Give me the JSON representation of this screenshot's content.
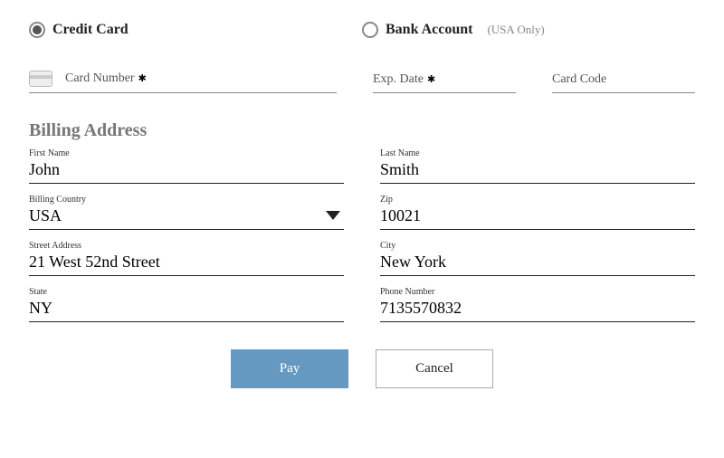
{
  "payment_method": {
    "credit_card_label": "Credit Card",
    "bank_account_label": "Bank Account",
    "bank_account_sub": "(USA Only)"
  },
  "card": {
    "number_label": "Card Number",
    "number_value": "",
    "exp_label": "Exp. Date",
    "exp_value": "",
    "code_label": "Card Code",
    "code_value": "",
    "required_mark": "✱"
  },
  "billing": {
    "title": "Billing Address",
    "first_name_label": "First Name",
    "first_name_value": "John",
    "last_name_label": "Last Name",
    "last_name_value": "Smith",
    "country_label": "Billing Country",
    "country_value": "USA",
    "zip_label": "Zip",
    "zip_value": "10021",
    "street_label": "Street Address",
    "street_value": "21 West 52nd Street",
    "city_label": "City",
    "city_value": "New York",
    "state_label": "State",
    "state_value": "NY",
    "phone_label": "Phone Number",
    "phone_value": "7135570832"
  },
  "actions": {
    "pay_label": "Pay",
    "cancel_label": "Cancel"
  }
}
